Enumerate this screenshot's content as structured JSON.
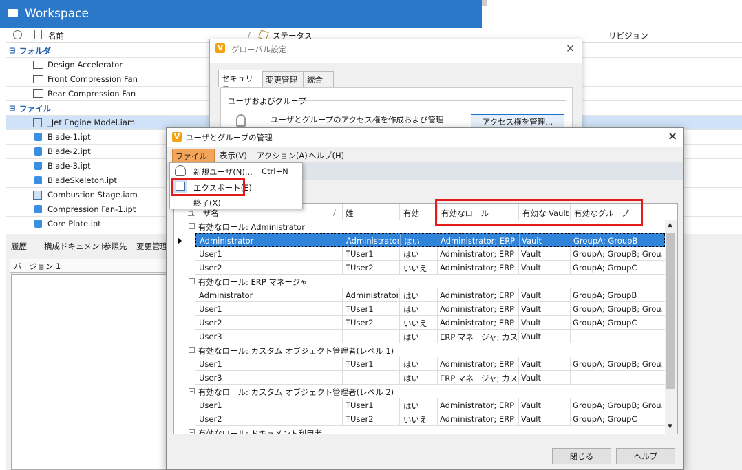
{
  "workspace": {
    "title": "Workspace",
    "columns": {
      "name": "名前",
      "status": "ステータス",
      "revision": "リビジョン"
    },
    "groups": [
      {
        "label": "フォルダ"
      },
      {
        "label": "ファイル"
      }
    ],
    "folders": [
      "Design Accelerator",
      "Front Compression Fan",
      "Rear Compression Fan"
    ],
    "files": [
      "_Jet Engine Model.iam",
      "Blade-1.ipt",
      "Blade-2.ipt",
      "Blade-3.ipt",
      "BladeSkeleton.ipt",
      "Combustion Stage.iam",
      "Compression Fan-1.ipt",
      "Core Plate.ipt"
    ],
    "bottom_tabs": [
      "履歴",
      "構成ドキュメント",
      "参照先",
      "変更管理"
    ],
    "version_label": "バージョン 1"
  },
  "global_settings": {
    "title": "グローバル設定",
    "tabs": [
      "セキュリティ",
      "変更管理",
      "統合"
    ],
    "section": "ユーザおよびグループ",
    "description": "ユーザとグループのアクセス権を作成および管理",
    "manage_button": "アクセス権を管理..."
  },
  "users_dialog": {
    "title": "ユーザとグループの管理",
    "menu": [
      "ファイル(F)",
      "表示(V)",
      "アクション(A)",
      "ヘルプ(H)"
    ],
    "file_menu": {
      "new_user": "新規ユーザ(N)...",
      "new_user_shortcut": "Ctrl+N",
      "export": "エクスポート(E)",
      "exit": "終了(X)"
    },
    "columns": [
      "ユーザ名",
      "姓",
      "有効",
      "有効なロール",
      "有効な Vault",
      "有効なグループ"
    ],
    "groups": [
      {
        "label": "有効なロール: Administrator",
        "rows": [
          [
            "Administrator",
            "Administrator",
            "はい",
            "Administrator; ERP ...",
            "Vault",
            "GroupA; GroupB"
          ],
          [
            "User1",
            "TUser1",
            "はい",
            "Administrator; ERP ...",
            "Vault",
            "GroupA; GroupB; Grou..."
          ],
          [
            "User2",
            "TUser2",
            "いいえ",
            "Administrator; ERP ...",
            "Vault",
            "GroupA; GroupC"
          ]
        ]
      },
      {
        "label": "有効なロール: ERP マネージャ",
        "rows": [
          [
            "Administrator",
            "Administrator",
            "はい",
            "Administrator; ERP ...",
            "Vault",
            "GroupA; GroupB"
          ],
          [
            "User1",
            "TUser1",
            "はい",
            "Administrator; ERP ...",
            "Vault",
            "GroupA; GroupB; Grou..."
          ],
          [
            "User2",
            "TUser2",
            "いいえ",
            "Administrator; ERP ...",
            "Vault",
            "GroupA; GroupC"
          ],
          [
            "User3",
            "",
            "はい",
            "ERP マネージャ; カスタ...",
            "Vault",
            ""
          ]
        ]
      },
      {
        "label": "有効なロール: カスタム オブジェクト管理者(レベル 1)",
        "rows": [
          [
            "User1",
            "TUser1",
            "はい",
            "Administrator; ERP ...",
            "Vault",
            "GroupA; GroupB; Grou..."
          ],
          [
            "User3",
            "",
            "はい",
            "ERP マネージャ; カスタ...",
            "Vault",
            ""
          ]
        ]
      },
      {
        "label": "有効なロール: カスタム オブジェクト管理者(レベル 2)",
        "rows": [
          [
            "User1",
            "TUser1",
            "はい",
            "Administrator; ERP ...",
            "Vault",
            "GroupA; GroupB; Grou..."
          ],
          [
            "User2",
            "TUser2",
            "いいえ",
            "Administrator; ERP ...",
            "Vault",
            "GroupA; GroupC"
          ]
        ]
      },
      {
        "label": "有効なロール: ドキュメント利用者",
        "rows": []
      }
    ],
    "close_button": "閉じる",
    "help_button": "ヘルプ"
  },
  "colors": {
    "accent": "#2b77c8",
    "highlight": "#e21b1b",
    "selected_row": "#2f84d9",
    "menu_active": "#f3a65b"
  }
}
